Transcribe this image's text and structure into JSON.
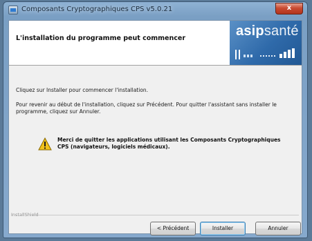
{
  "window": {
    "title": "Composants Cryptographiques CPS v5.0.21",
    "close_label": "x"
  },
  "header": {
    "title": "L'installation du programme peut commencer",
    "logo": {
      "part1": "asip",
      "part2": "santé"
    }
  },
  "body": {
    "line1": "Cliquez sur Installer pour commencer l'installation.",
    "line2": "Pour revenir au début de l'installation, cliquez sur Précédent. Pour quitter l'assistant sans installer le programme, cliquez sur Annuler.",
    "warning": "Merci de quitter les applications utilisant les Composants Cryptographiques CPS (navigateurs, logiciels médicaux)."
  },
  "footer": {
    "label": "InstallShield"
  },
  "buttons": {
    "previous": "< Précédent",
    "install": "Installer",
    "cancel": "Annuler"
  },
  "colors": {
    "logo_background": "#2f6aaa",
    "close_button": "#c94a31",
    "warning_icon": "#f2c21b"
  }
}
